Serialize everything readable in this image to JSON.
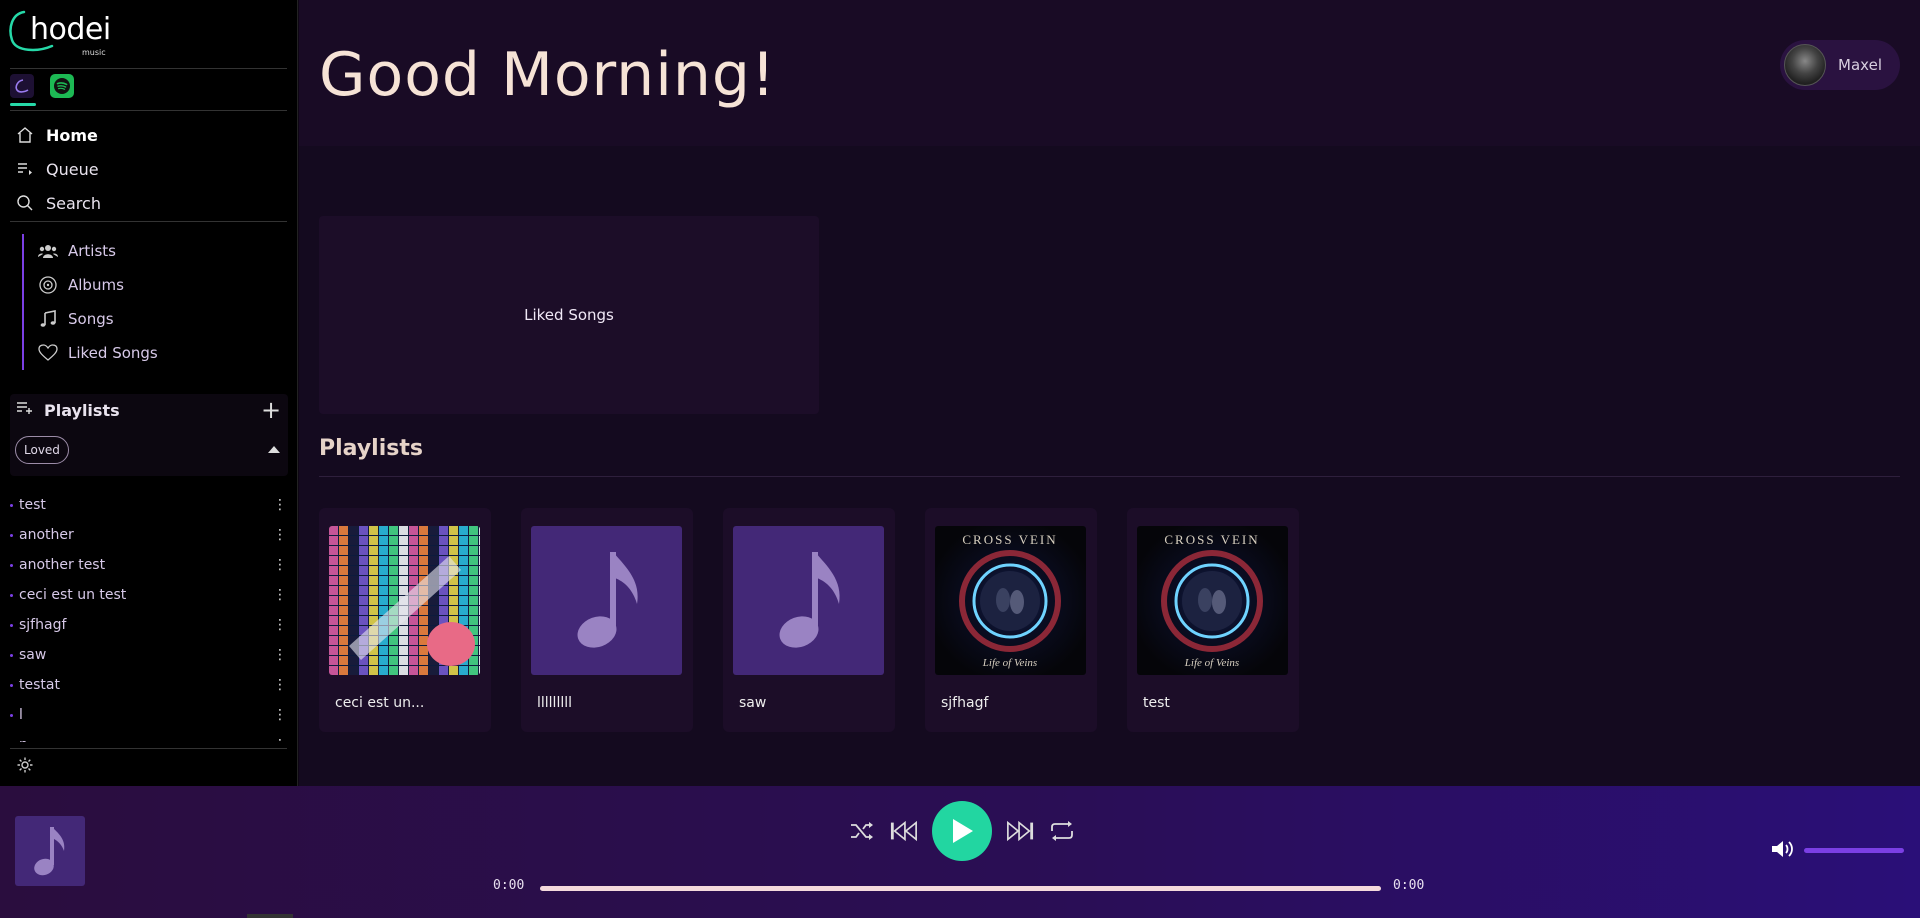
{
  "brand": {
    "name": "hodei",
    "sub": "music"
  },
  "nav": {
    "home": "Home",
    "queue": "Queue",
    "search": "Search"
  },
  "library": {
    "artists": "Artists",
    "albums": "Albums",
    "songs": "Songs",
    "liked": "Liked Songs"
  },
  "playlists_panel": {
    "title": "Playlists",
    "filter": "Loved"
  },
  "playlist_list": [
    "test",
    "another",
    "another test",
    "ceci est un test",
    "sjfhagf",
    "saw",
    "testat",
    "l",
    "n"
  ],
  "header": {
    "greeting": "Good Morning!",
    "user": "Maxel"
  },
  "main": {
    "liked_card": "Liked Songs",
    "section_title": "Playlists",
    "cards": [
      {
        "name": "ceci est un...",
        "art": "pixel-art-cover"
      },
      {
        "name": "lllllllll",
        "art": "music-note"
      },
      {
        "name": "saw",
        "art": "music-note"
      },
      {
        "name": "sjfhagf",
        "art": "cross-vein-cover"
      },
      {
        "name": "test",
        "art": "cross-vein-cover"
      }
    ],
    "cover_text": {
      "band": "CROSS VEIN",
      "album": "Life of Veins"
    }
  },
  "player": {
    "time_current": "0:00",
    "time_total": "0:00",
    "progress": 0,
    "volume": 1
  },
  "colors": {
    "accent": "#22d6a1",
    "purple": "#7b3fe4",
    "note_bg": "#432877"
  }
}
